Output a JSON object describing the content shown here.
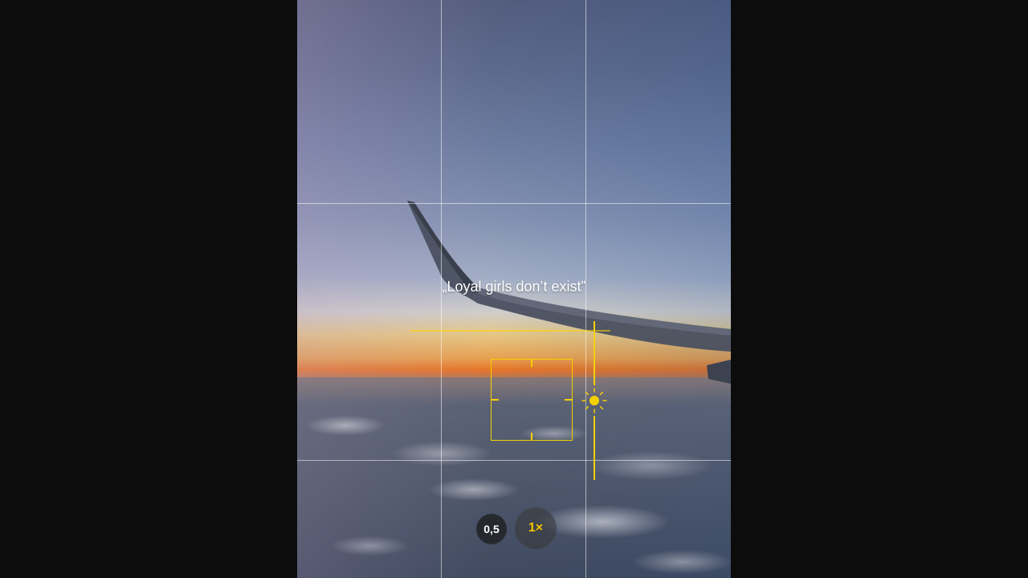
{
  "camera": {
    "caption": "„Loyal girls don’t exist”",
    "zoom_options": [
      "0,5",
      "1×"
    ],
    "active_zoom": "1×",
    "accent_color": "#f5d000",
    "exposure_icon": "sun-icon",
    "grid": "3x3"
  }
}
